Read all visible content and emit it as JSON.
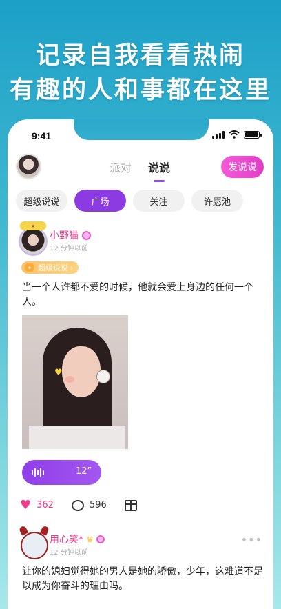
{
  "headline": {
    "line1": "记录自我看看热闹",
    "line2": "有趣的人和事都在这里"
  },
  "status_bar": {
    "time": "9:41"
  },
  "header": {
    "tabs": [
      {
        "label": "派对",
        "active": false
      },
      {
        "label": "说说",
        "active": true
      }
    ],
    "post_button": "发说说"
  },
  "filter_chips": [
    {
      "label": "超级说说",
      "active": false
    },
    {
      "label": "广场",
      "active": true
    },
    {
      "label": "关注",
      "active": false
    },
    {
      "label": "许愿池",
      "active": false
    }
  ],
  "posts": [
    {
      "username": "小野猫",
      "time": "12 分钟以前",
      "tag": "超级说说",
      "text": "当一个人谁都不爱的时候，他就会爱上身边的任何一个人。",
      "voice_duration": "12”",
      "likes": "362",
      "comments": "596"
    },
    {
      "username": "用心笑*",
      "time": "12 分钟以前",
      "text": "让你的媳妇觉得她的男人是她的骄傲，少年，这难道不足以成为你奋斗的理由吗。"
    }
  ],
  "colors": {
    "accent_purple": "#8c3be3",
    "accent_pink": "#f0398a",
    "background_top": "#1ca0c8",
    "background_bottom": "#a6e8ea"
  },
  "icons": [
    "signal-icon",
    "wifi-icon",
    "battery-icon",
    "heart-icon",
    "comment-icon",
    "gift-icon",
    "more-icon",
    "voice-wave-icon"
  ]
}
